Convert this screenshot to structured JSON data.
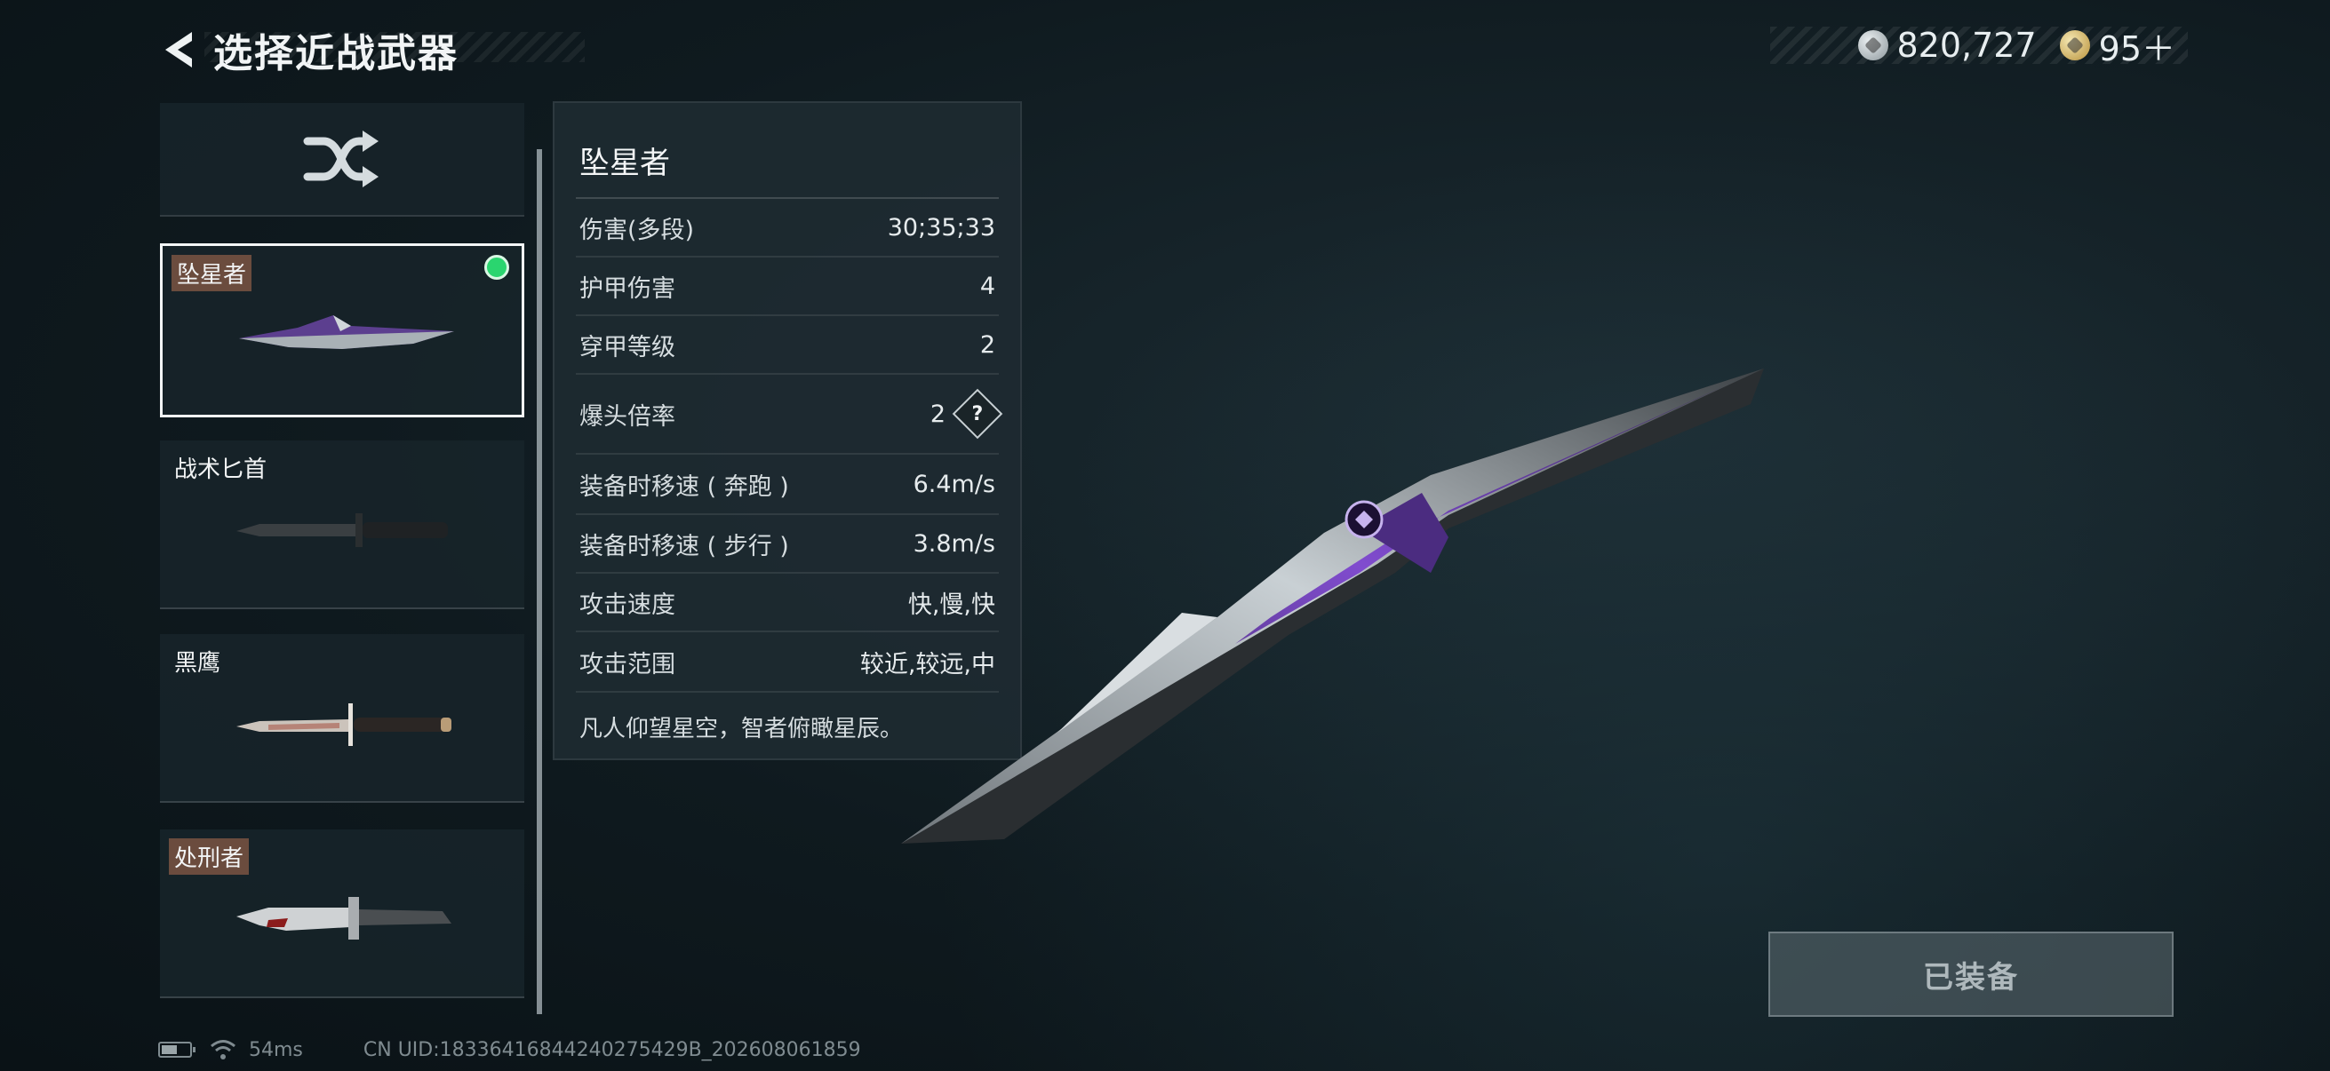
{
  "header": {
    "title": "选择近战武器"
  },
  "currency": {
    "silver": "820,727",
    "gold": "95＋"
  },
  "weapons": [
    {
      "name": "坠星者",
      "tagged": true,
      "equipped": true
    },
    {
      "name": "战术匕首",
      "tagged": false
    },
    {
      "name": "黑鹰",
      "tagged": false
    },
    {
      "name": "处刑者",
      "tagged": true
    }
  ],
  "stats": {
    "title": "坠星者",
    "rows": [
      {
        "label": "伤害(多段)",
        "value": "30;35;33"
      },
      {
        "label": "护甲伤害",
        "value": "4"
      },
      {
        "label": "穿甲等级",
        "value": "2"
      },
      {
        "label": "爆头倍率",
        "value": "2"
      },
      {
        "label": "装备时移速 ( 奔跑 )",
        "value": "6.4m/s"
      },
      {
        "label": "装备时移速 ( 步行 )",
        "value": "3.8m/s"
      },
      {
        "label": "攻击速度",
        "value": "快,慢,快"
      },
      {
        "label": "攻击范围",
        "value": "较近,较远,中"
      }
    ],
    "help_glyph": "?",
    "description": "凡人仰望星空，智者俯瞰星辰。"
  },
  "equip_button": "已装备",
  "footer": {
    "battery_level": 0.55,
    "ping": "54ms",
    "uid": "CN UID:18336416844240275429B_202608061859"
  },
  "colors": {
    "equipped_dot": "#2ad56f",
    "tag_bg": "#6b4c3e",
    "blade_purple": "#7a3fd0"
  }
}
